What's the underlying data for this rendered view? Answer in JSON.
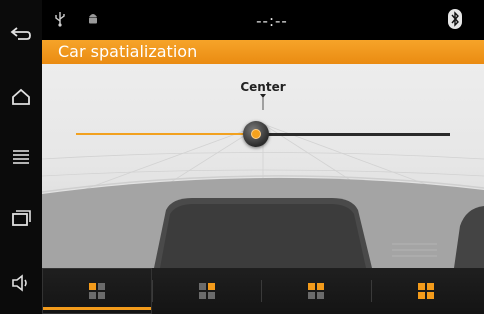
{
  "title": "Car spatialization",
  "status_bar": {
    "clock": "--:--",
    "icons": [
      "usb-icon",
      "android-debug-icon",
      "bluetooth-icon"
    ]
  },
  "nav_buttons": [
    "back-icon",
    "home-icon",
    "menu-icon",
    "recent-apps-icon",
    "volume-icon"
  ],
  "slider": {
    "label": "Center",
    "value": 0.5
  },
  "tabs": [
    {
      "name": "tab-front-left",
      "icon": "quadrant-grid-icon",
      "highlight": [
        1,
        0,
        0,
        0
      ],
      "active": true
    },
    {
      "name": "tab-front-right",
      "icon": "quadrant-grid-icon",
      "highlight": [
        0,
        1,
        0,
        0
      ],
      "active": false
    },
    {
      "name": "tab-rear-left",
      "icon": "quadrant-grid-icon",
      "highlight": [
        1,
        1,
        0,
        0
      ],
      "active": false
    },
    {
      "name": "tab-rear-right",
      "icon": "quadrant-grid-icon",
      "highlight": [
        1,
        1,
        1,
        1
      ],
      "active": false
    }
  ],
  "colors": {
    "accent": "#f39b1b",
    "title_bar": "#ef961a",
    "background": "#000000"
  }
}
